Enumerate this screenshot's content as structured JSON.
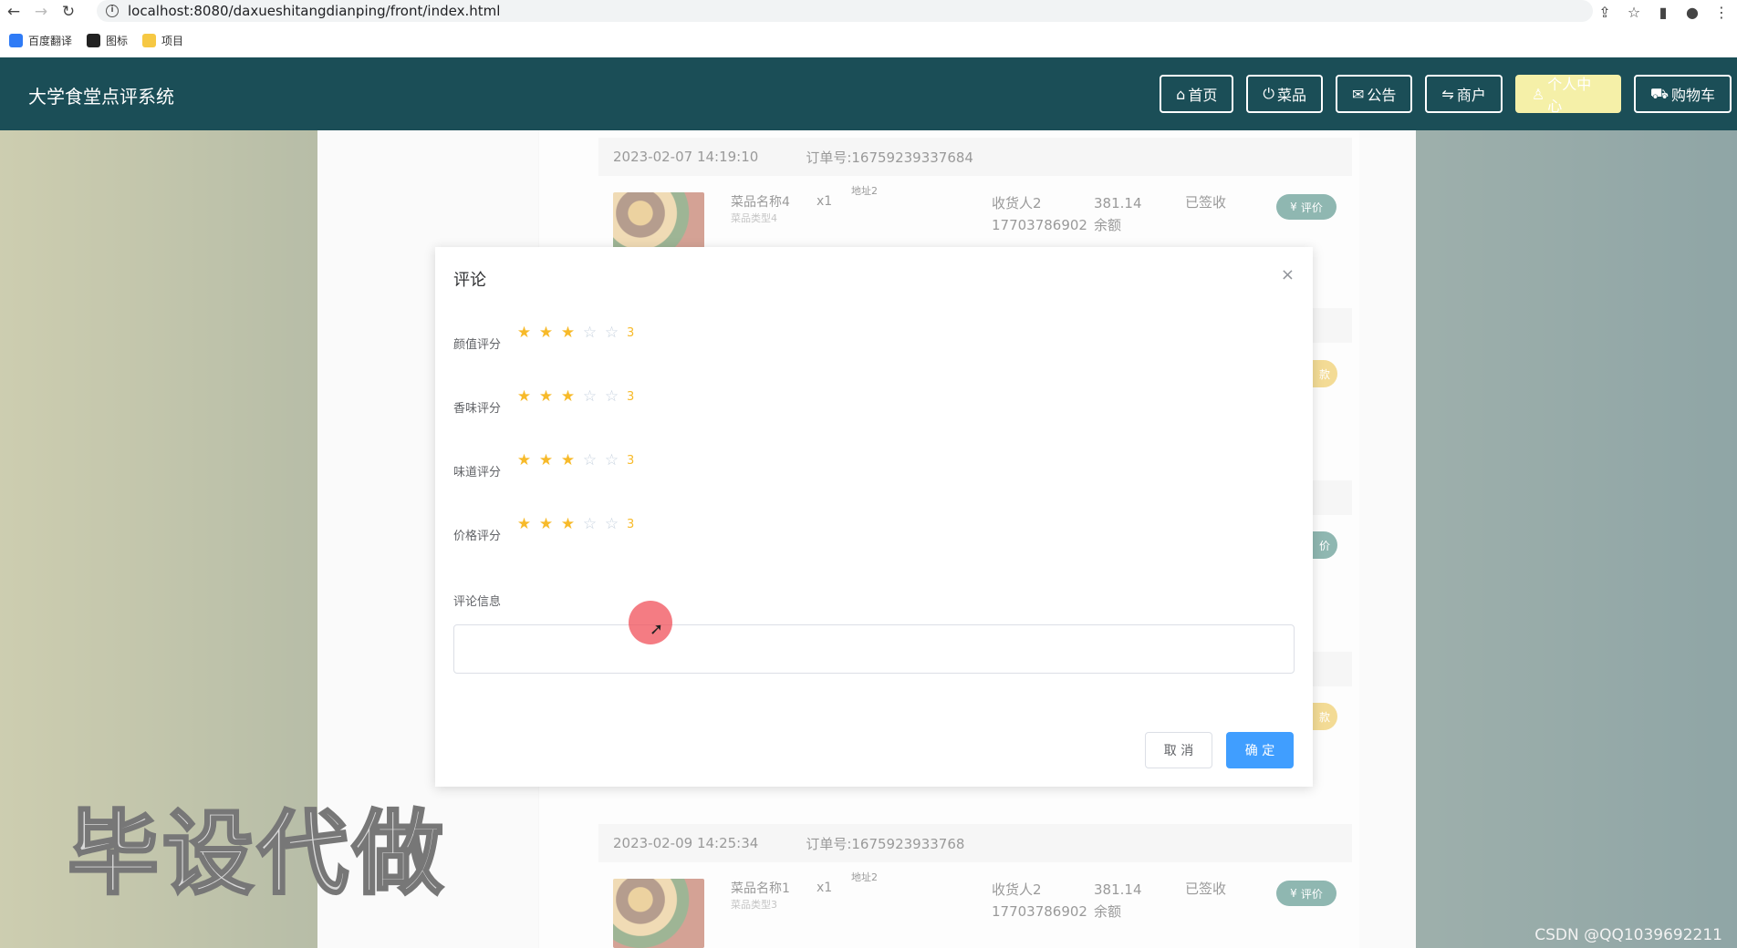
{
  "browser": {
    "url": "localhost:8080/daxueshitangdianping/front/index.html",
    "bookmarks": [
      {
        "label": "百度翻译",
        "color": "#2f7bf6"
      },
      {
        "label": "图标",
        "color": "#222222"
      },
      {
        "label": "项目",
        "color": "#f6c843"
      }
    ]
  },
  "header": {
    "site_title": "大学食堂点评系统",
    "nav": [
      {
        "label": "首页",
        "icon": "home-icon",
        "glyph": "⌂"
      },
      {
        "label": "菜品",
        "icon": "power-icon",
        "glyph": "⏻"
      },
      {
        "label": "公告",
        "icon": "mail-icon",
        "glyph": "✉"
      },
      {
        "label": "商户",
        "icon": "sliders-icon",
        "glyph": "⇋"
      },
      {
        "label": "个人中心",
        "icon": "user-icon",
        "glyph": "♙"
      },
      {
        "label": "购物车",
        "icon": "cart-icon",
        "glyph": "🛒"
      }
    ]
  },
  "orders": [
    {
      "time": "2023-02-07 14:19:10",
      "order_no": "订单号:16759239337684",
      "dish_name": "菜品名称4",
      "dish_type": "菜品类型4",
      "qty": "x1",
      "address": "地址2",
      "receiver": "收货人2",
      "phone": "17703786902",
      "price": "381.14",
      "pay_method": "余额",
      "status": "已签收",
      "action": "评价"
    },
    {
      "time": "2023-02-09 14:25:34",
      "order_no": "订单号:1675923933768",
      "dish_name": "菜品名称1",
      "dish_type": "菜品类型3",
      "qty": "x1",
      "address": "地址2",
      "receiver": "收货人2",
      "phone": "17703786902",
      "price": "381.14",
      "pay_method": "余额",
      "status": "已签收",
      "action": "评价"
    }
  ],
  "side_pills": [
    "款",
    "价",
    "款"
  ],
  "modal": {
    "title": "评论",
    "close": "×",
    "ratings": [
      {
        "label": "颜值评分",
        "value": 3,
        "max": 5,
        "text": "3"
      },
      {
        "label": "香味评分",
        "value": 3,
        "max": 5,
        "text": "3"
      },
      {
        "label": "味道评分",
        "value": 3,
        "max": 5,
        "text": "3"
      },
      {
        "label": "价格评分",
        "value": 3,
        "max": 5,
        "text": "3"
      }
    ],
    "comment_label": "评论信息",
    "comment_value": "",
    "cancel": "取 消",
    "confirm": "确 定"
  },
  "watermark": "毕设代做",
  "csdn": "CSDN @QQ1039692211"
}
